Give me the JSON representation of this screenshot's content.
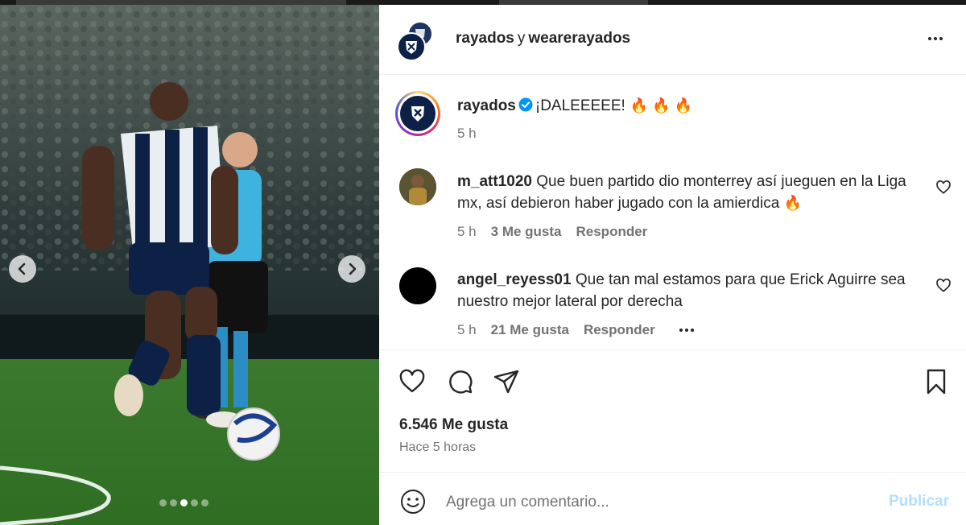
{
  "header": {
    "user1": "rayados",
    "conjunction": "y",
    "user2": "wearerayados",
    "more_icon": "more-horizontal-icon"
  },
  "caption": {
    "username": "rayados",
    "verified_icon": "verified-badge-icon",
    "text": "¡DALEEEEE!",
    "emojis": "🔥 🔥 🔥",
    "time": "5 h"
  },
  "comments": [
    {
      "username": "m_att1020",
      "text": "Que buen partido dio monterrey así jueguen en la Liga mx, así debieron haber jugado con la amierdica",
      "emoji": "🔥",
      "time": "5 h",
      "likes": "3 Me gusta",
      "reply": "Responder"
    },
    {
      "username": "angel_reyess01",
      "text": "Que tan mal estamos para que Erick Aguirre sea nuestro mejor lateral por derecha",
      "time": "5 h",
      "likes": "21 Me gusta",
      "reply": "Responder"
    }
  ],
  "actions": {
    "like_icon": "heart-icon",
    "comment_icon": "comment-icon",
    "share_icon": "send-icon",
    "save_icon": "bookmark-icon"
  },
  "likes_count": "6.546 Me gusta",
  "posted": "Hace 5 horas",
  "composer": {
    "emoji_icon": "smiley-icon",
    "placeholder": "Agrega un comentario...",
    "submit": "Publicar"
  },
  "carousel": {
    "slide_count": 5,
    "active_slide": 3,
    "prev_icon": "chevron-left-icon",
    "next_icon": "chevron-right-icon"
  },
  "colors": {
    "link_blue": "#b2dffc",
    "verified_blue": "#0095f6",
    "muted_text": "#737373"
  }
}
